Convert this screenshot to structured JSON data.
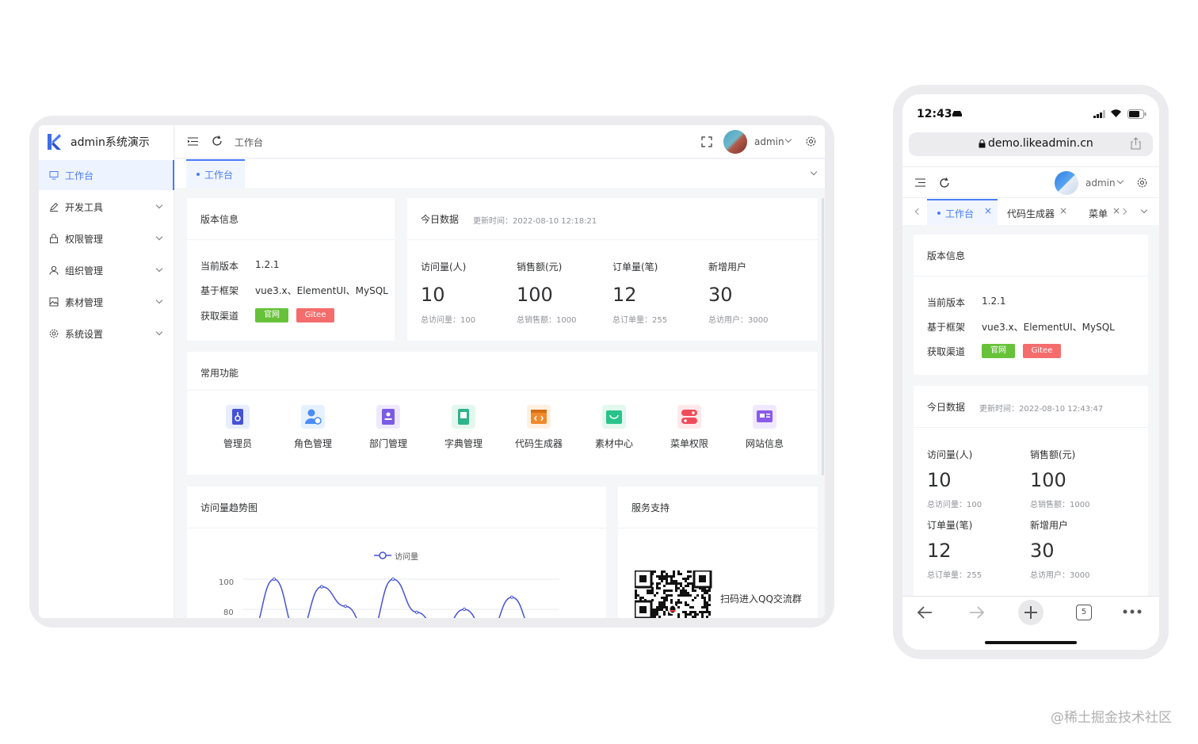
{
  "app": {
    "title": "admin系统演示"
  },
  "sidebar": {
    "items": [
      {
        "label": "工作台",
        "icon": "monitor-icon"
      },
      {
        "label": "开发工具",
        "icon": "pen-icon"
      },
      {
        "label": "权限管理",
        "icon": "lock-icon"
      },
      {
        "label": "组织管理",
        "icon": "user-icon"
      },
      {
        "label": "素材管理",
        "icon": "image-icon"
      },
      {
        "label": "系统设置",
        "icon": "gear-icon"
      }
    ]
  },
  "topbar": {
    "breadcrumb": "工作台",
    "user": "admin"
  },
  "tabs": {
    "active": "工作台"
  },
  "version_card": {
    "title": "版本信息",
    "rows": [
      {
        "label": "当前版本",
        "value": "1.2.1"
      },
      {
        "label": "基于框架",
        "value": "vue3.x、ElementUI、MySQL"
      },
      {
        "label": "获取渠道",
        "value": ""
      }
    ],
    "btn_official": "官网",
    "btn_gitee": "Gitee"
  },
  "today_card": {
    "title": "今日数据",
    "update": "更新时间：2022-08-10 12:18:21",
    "stats": [
      {
        "label": "访问量(人)",
        "value": "10",
        "sub": "总访问量：100"
      },
      {
        "label": "销售额(元)",
        "value": "100",
        "sub": "总销售额：1000"
      },
      {
        "label": "订单量(笔)",
        "value": "12",
        "sub": "总订单量：255"
      },
      {
        "label": "新增用户",
        "value": "30",
        "sub": "总访用户：3000"
      }
    ]
  },
  "functions_card": {
    "title": "常用功能",
    "items": [
      "管理员",
      "角色管理",
      "部门管理",
      "字典管理",
      "代码生成器",
      "素材中心",
      "菜单权限",
      "网站信息"
    ]
  },
  "trend_card": {
    "title": "访问量趋势图"
  },
  "chart_data": {
    "type": "line",
    "legend": "访问量",
    "yticks": [
      "100",
      "80"
    ],
    "series": [
      {
        "name": "访问量",
        "values": [
          0,
          100,
          0,
          95,
          82,
          0,
          100,
          78,
          0,
          80,
          0,
          88,
          0
        ]
      }
    ]
  },
  "support_card": {
    "title": "服务支持",
    "qr_text": "扫码进入QQ交流群"
  },
  "phone": {
    "time": "12:43",
    "url": "demo.likeadmin.cn",
    "user": "admin",
    "tabs": [
      "工作台",
      "代码生成器",
      "菜单"
    ],
    "version": {
      "title": "版本信息",
      "rows": [
        {
          "label": "当前版本",
          "value": "1.2.1"
        },
        {
          "label": "基于框架",
          "value": "vue3.x、ElementUI、MySQL"
        },
        {
          "label": "获取渠道",
          "value": ""
        }
      ],
      "btn_official": "官网",
      "btn_gitee": "Gitee"
    },
    "today": {
      "title": "今日数据",
      "update": "更新时间：2022-08-10 12:43:47",
      "stats": [
        {
          "label": "访问量(人)",
          "value": "10",
          "sub": "总访问量：100"
        },
        {
          "label": "销售额(元)",
          "value": "100",
          "sub": "总销售额：1000"
        },
        {
          "label": "订单量(笔)",
          "value": "12",
          "sub": "总订单量：255"
        },
        {
          "label": "新增用户",
          "value": "30",
          "sub": "总访用户：3000"
        }
      ]
    },
    "tab_count": "5"
  },
  "watermark": "@稀土掘金技术社区",
  "colors": {
    "primary": "#4a7cf6",
    "success": "#67c23a",
    "danger": "#f56c6c"
  }
}
